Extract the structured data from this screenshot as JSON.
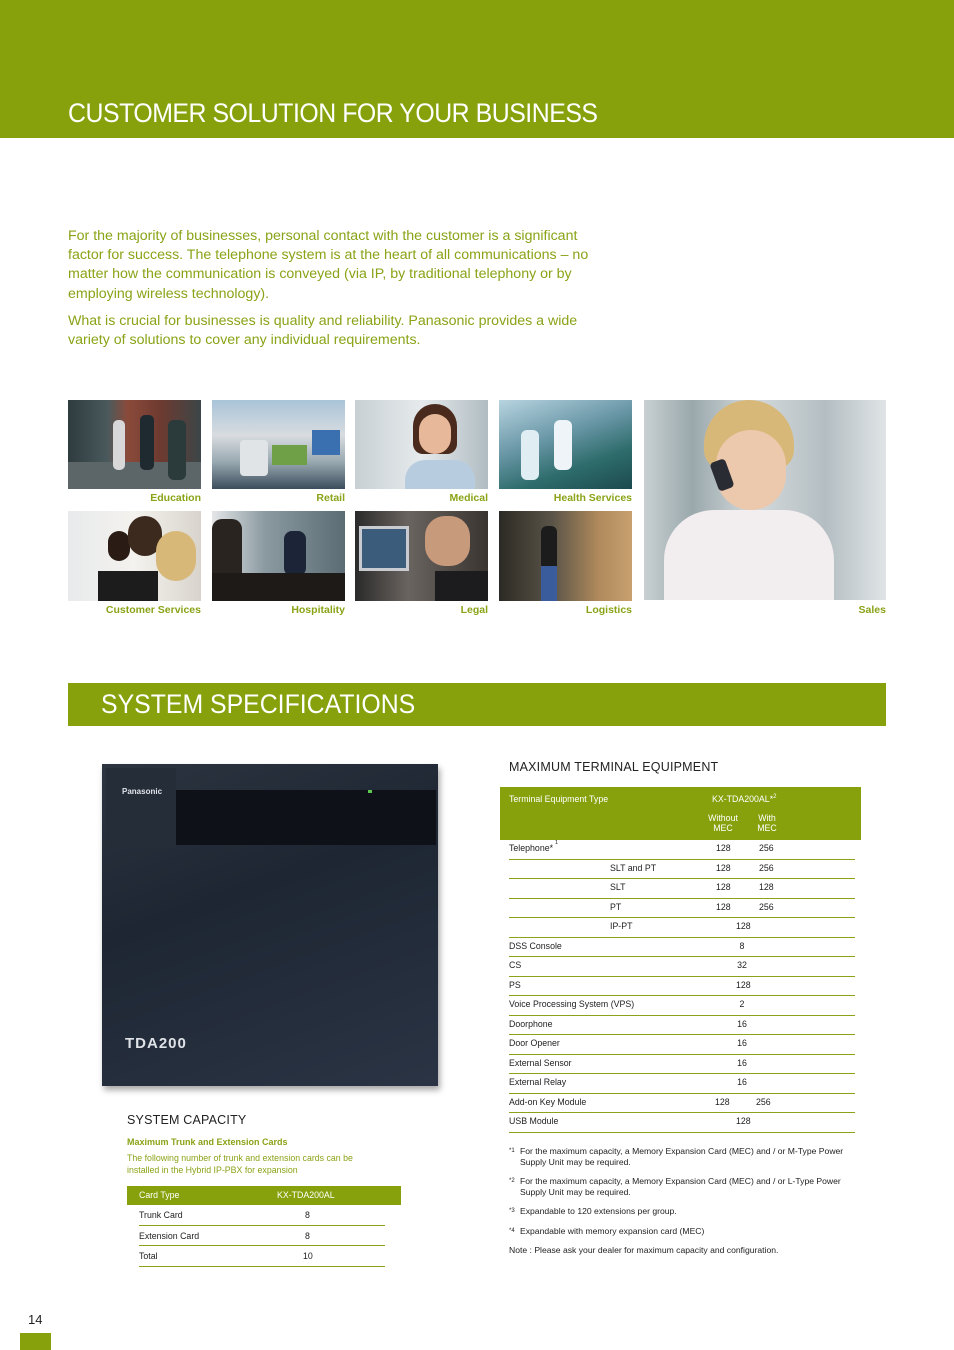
{
  "header": {
    "title": "CUSTOMER SOLUTION  FOR YOUR BUSINESS"
  },
  "intro": {
    "paragraphs": [
      "For the majority of businesses, personal contact with the customer is a significant factor for success. The telephone system is at the heart of all communications – no matter how the communication is conveyed (via IP, by traditional telephony or by employing wireless technology).",
      "What is crucial for businesses is quality and reliability. Panasonic provides a wide variety of solutions to cover any individual requirements."
    ]
  },
  "gallery": [
    {
      "label": "Education"
    },
    {
      "label": "Retail"
    },
    {
      "label": "Medical"
    },
    {
      "label": "Health Services"
    },
    {
      "label": "Customer Services"
    },
    {
      "label": "Hospitality"
    },
    {
      "label": "Legal"
    },
    {
      "label": "Logistics"
    },
    {
      "label": "Sales"
    }
  ],
  "specs": {
    "title": "SYSTEM SPECIFICATIONS",
    "product": {
      "brand": "Panasonic",
      "model_badge": "TDA200"
    },
    "capacity": {
      "heading": "SYSTEM CAPACITY",
      "subheading": "Maximum Trunk and Extension Cards",
      "description": "The following number of trunk and extension cards  can be installed in the Hybrid IP-PBX for expansion",
      "columns": [
        "Card Type",
        "KX-TDA200AL"
      ],
      "rows": [
        {
          "type": "Trunk Card",
          "value": "8"
        },
        {
          "type": "Extension Card",
          "value": "8"
        },
        {
          "type": "Total",
          "value": "10"
        }
      ]
    },
    "terminal": {
      "heading": "MAXIMUM TERMINAL EQUIPMENT",
      "col_type": "Terminal Equipment Type",
      "col_model": "KX-TDA200AL*",
      "col_model_sup": "2",
      "col_without": "Without MEC",
      "col_with": "With MEC",
      "rows": [
        {
          "label": "Telephone*",
          "sup": "1",
          "sub": "",
          "without": "128",
          "with": "256",
          "single": ""
        },
        {
          "label": "",
          "sup": "",
          "sub": "SLT and PT",
          "without": "128",
          "with": "256",
          "single": ""
        },
        {
          "label": "",
          "sup": "",
          "sub": "SLT",
          "without": "128",
          "with": "128",
          "single": ""
        },
        {
          "label": "",
          "sup": "",
          "sub": "PT",
          "without": "128",
          "with": "256",
          "single": ""
        },
        {
          "label": "",
          "sup": "",
          "sub": "IP-PT",
          "without": "",
          "with": "",
          "single": "128"
        },
        {
          "label": "DSS Console",
          "sup": "",
          "sub": "",
          "without": "",
          "with": "",
          "single": "8"
        },
        {
          "label": "CS",
          "sup": "",
          "sub": "",
          "without": "",
          "with": "",
          "single": "32"
        },
        {
          "label": "PS",
          "sup": "",
          "sub": "",
          "without": "",
          "with": "",
          "single": "128"
        },
        {
          "label": "Voice Processing System (VPS)",
          "sup": "",
          "sub": "",
          "without": "",
          "with": "",
          "single": "2"
        },
        {
          "label": "Doorphone",
          "sup": "",
          "sub": "",
          "without": "",
          "with": "",
          "single": "16"
        },
        {
          "label": "Door Opener",
          "sup": "",
          "sub": "",
          "without": "",
          "with": "",
          "single": "16"
        },
        {
          "label": "External Sensor",
          "sup": "",
          "sub": "",
          "without": "",
          "with": "",
          "single": "16"
        },
        {
          "label": "External Relay",
          "sup": "",
          "sub": "",
          "without": "",
          "with": "",
          "single": "16"
        },
        {
          "label": "Add-on Key Module",
          "sup": "",
          "sub": "",
          "without": "128",
          "with": "256",
          "single": ""
        },
        {
          "label": "USB Module",
          "sup": "",
          "sub": "",
          "without": "",
          "with": "",
          "single": "128"
        }
      ],
      "footnotes": [
        {
          "mark": "*1",
          "text": "For the maximum capacity, a Memory Expansion Card (MEC) and / or M-Type Power Supply Unit may be required."
        },
        {
          "mark": "*2",
          "text": "For the maximum capacity, a Memory Expansion Card (MEC) and / or L-Type Power Supply Unit may be required."
        },
        {
          "mark": "*3",
          "text": "Expandable to 120 extensions per group."
        },
        {
          "mark": "*4",
          "text": "Expandable with memory expansion card (MEC)"
        }
      ],
      "note": "Note : Please ask your dealer for maximum capacity and configuration."
    }
  },
  "footer": {
    "page_number": "14"
  },
  "colors": {
    "brand_green": "#87a10c",
    "text_green": "#8aa317"
  }
}
